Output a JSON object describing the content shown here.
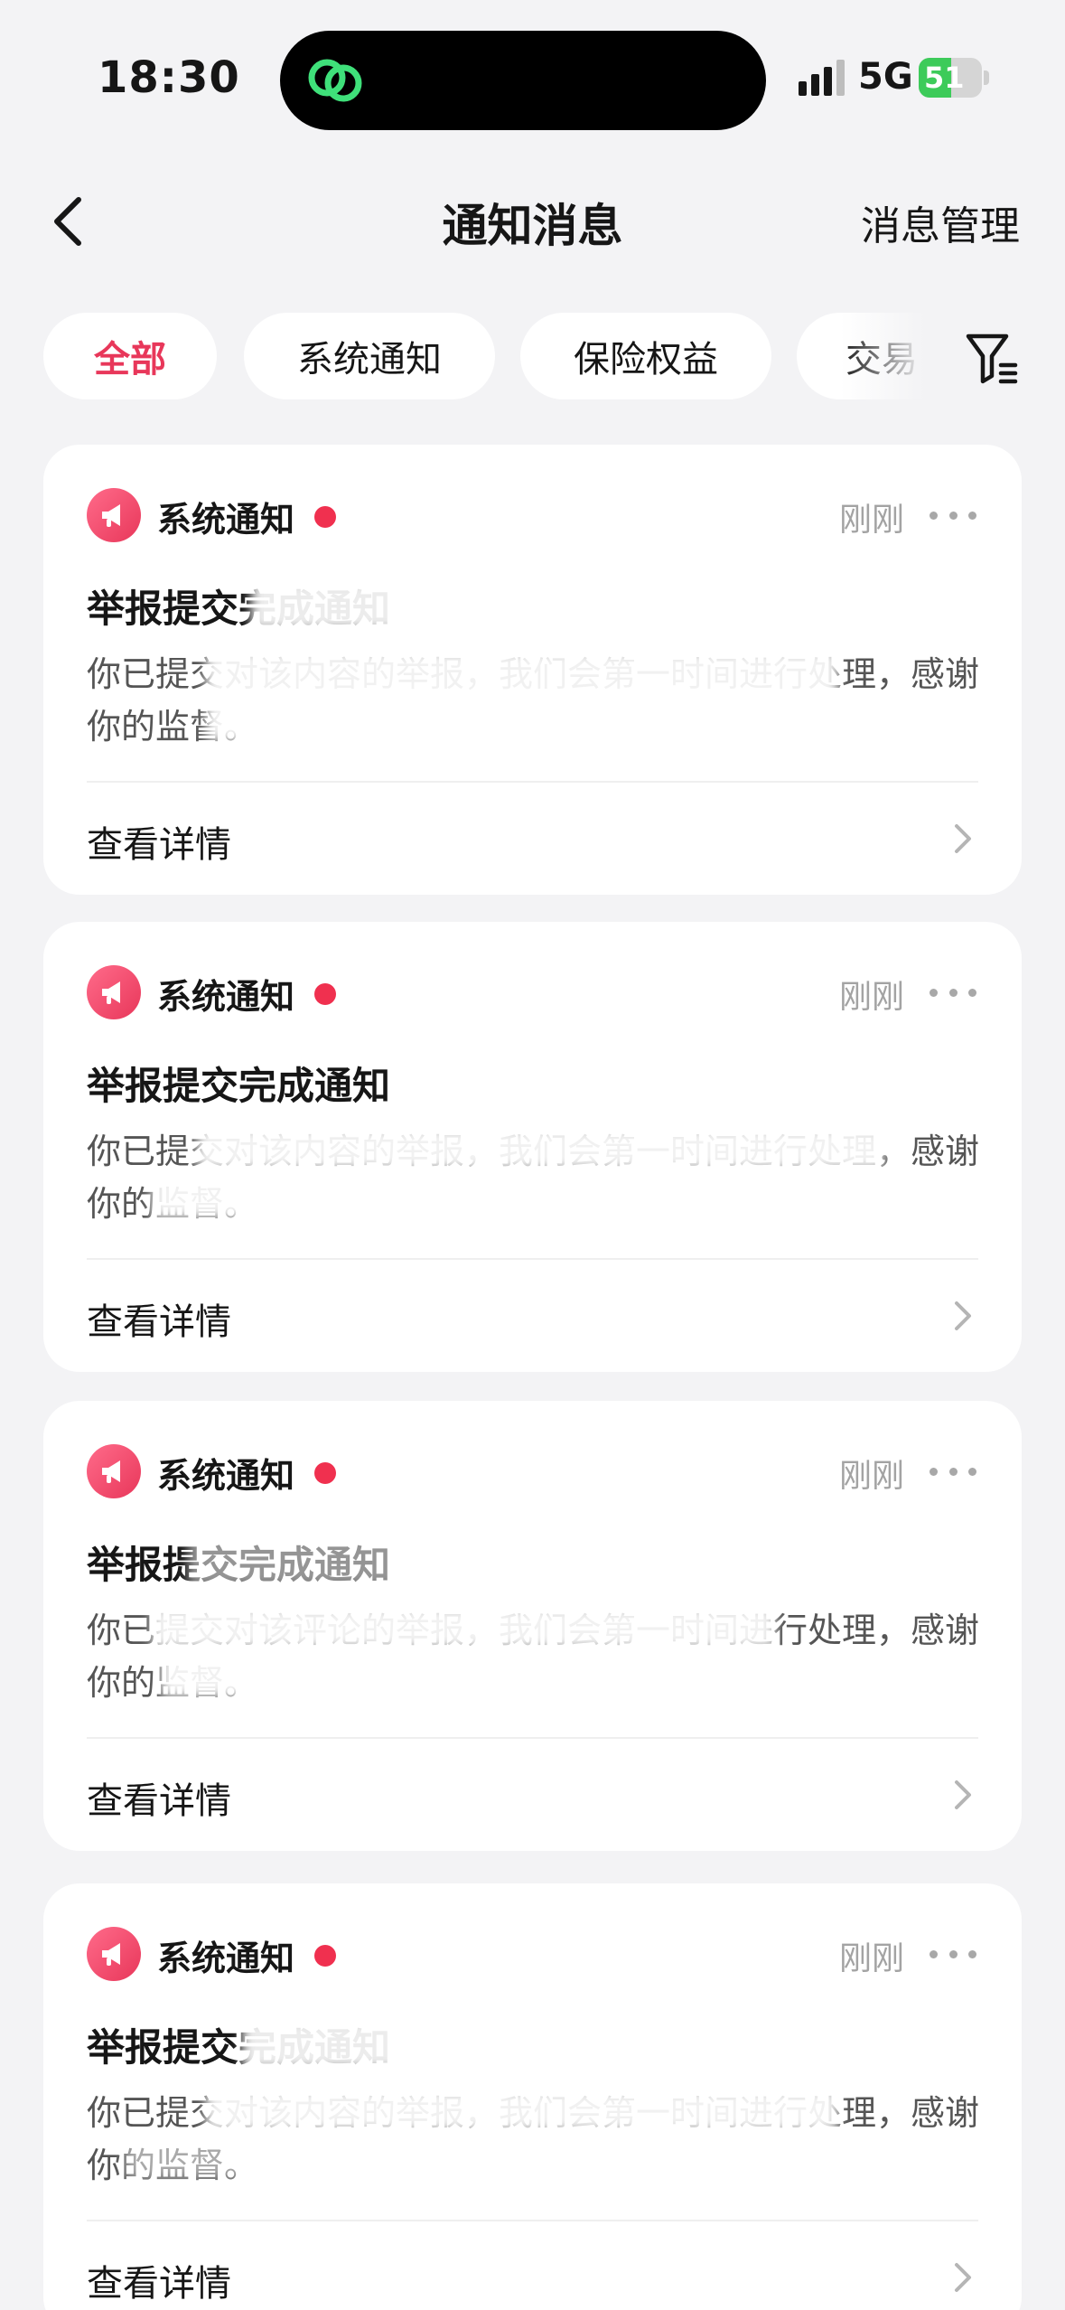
{
  "status_bar": {
    "time": "18:30",
    "network": "5G",
    "battery_level": "51",
    "battery_fraction": 0.51,
    "island_icon": "link-rings-icon",
    "signal_icon": "cellular-signal-icon"
  },
  "nav": {
    "title": "通知消息",
    "manage_label": "消息管理",
    "back_icon": "chevron-left-icon"
  },
  "filters": {
    "chips": [
      {
        "label": "全部",
        "active": true
      },
      {
        "label": "系统通知",
        "active": false
      },
      {
        "label": "保险权益",
        "active": false
      },
      {
        "label": "交易",
        "active": false
      }
    ],
    "filter_icon": "filter-funnel-icon"
  },
  "notifications": [
    {
      "source": "系统通知",
      "time": "刚刚",
      "title": "举报提交完成通知",
      "body": "你已提交对该内容的举报，我们会第一时间进行处理，感谢你的监督。",
      "action": "查看详情"
    },
    {
      "source": "系统通知",
      "time": "刚刚",
      "title": "举报提交完成通知",
      "body": "你已提交对该内容的举报，我们会第一时间进行处理，感谢你的监督。",
      "action": "查看详情"
    },
    {
      "source": "系统通知",
      "time": "刚刚",
      "title": "举报提交完成通知",
      "body": "你已提交对该评论的举报，我们会第一时间进行处理，感谢你的监督。",
      "action": "查看详情"
    },
    {
      "source": "系统通知",
      "time": "刚刚",
      "title": "举报提交完成通知",
      "body": "你已提交对该内容的举报，我们会第一时间进行处理，感谢你的监督。",
      "action": "查看详情"
    }
  ],
  "colors": {
    "accent": "#E8375A",
    "unread_dot": "#F0304F",
    "background": "#F3F3F5",
    "card": "#FFFFFF"
  }
}
